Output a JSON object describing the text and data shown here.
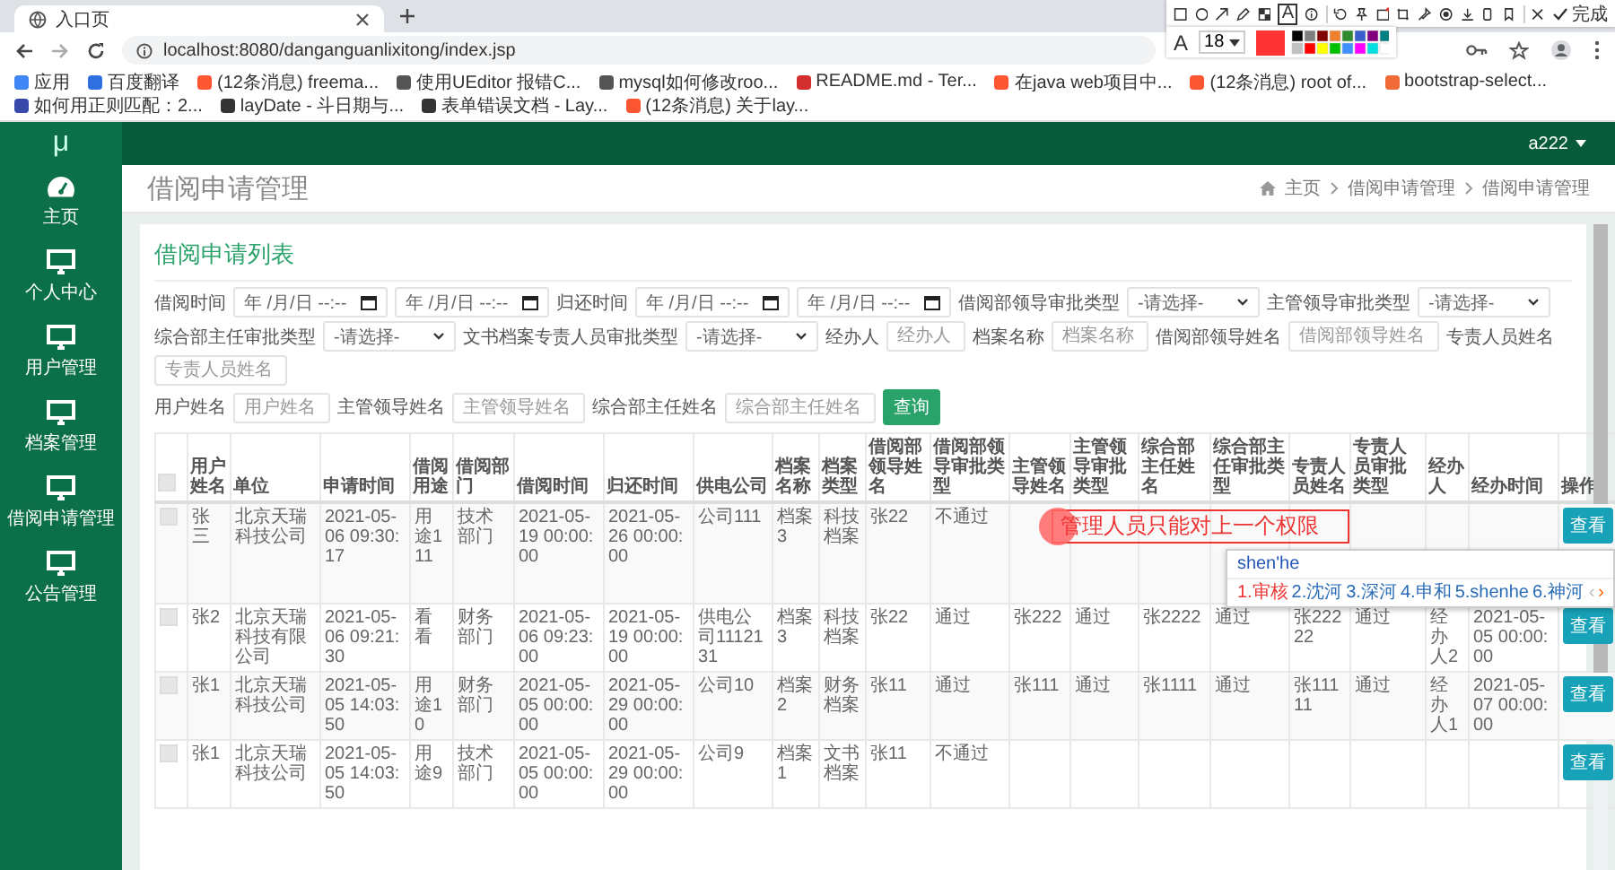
{
  "browser": {
    "tab": "入口页",
    "url": "localhost:8080/danganguanlixitong/index.jsp",
    "bookmarks": [
      {
        "label": "应用",
        "color": "#4285f4"
      },
      {
        "label": "百度翻译",
        "color": "#2f6fe0"
      },
      {
        "label": "(12条消息) freema...",
        "color": "#fc5531"
      },
      {
        "label": "使用UEditor 报错C...",
        "color": "#555555"
      },
      {
        "label": "mysql如何修改roo...",
        "color": "#555555"
      },
      {
        "label": "README.md - Ter...",
        "color": "#d32f2f"
      },
      {
        "label": "在java web项目中...",
        "color": "#fc5531"
      },
      {
        "label": "(12条消息) root of...",
        "color": "#fc5531"
      },
      {
        "label": "bootstrap-select...",
        "color": "#f06a3a"
      },
      {
        "label": "如何用正则匹配：2...",
        "color": "#3949ab"
      },
      {
        "label": "layDate - 斗日期与...",
        "color": "#333333"
      },
      {
        "label": "表单错误文档 - Lay...",
        "color": "#333333"
      },
      {
        "label": "(12条消息) 关于lay...",
        "color": "#fc5531"
      }
    ]
  },
  "annotation_toolbar": {
    "text_tool": "A",
    "font_tool": "A",
    "font_size": "18",
    "done": "完成"
  },
  "header": {
    "logo": "μ",
    "user": "a222"
  },
  "sidebar": {
    "items": [
      {
        "label": "主页",
        "kind": "gauge"
      },
      {
        "label": "个人中心",
        "kind": "monitor"
      },
      {
        "label": "用户管理",
        "kind": "monitor"
      },
      {
        "label": "档案管理",
        "kind": "monitor"
      },
      {
        "label": "借阅申请管理",
        "kind": "monitor"
      },
      {
        "label": "公告管理",
        "kind": "monitor"
      }
    ]
  },
  "page": {
    "title": "借阅申请管理",
    "breadcrumb": [
      "主页",
      "借阅申请管理",
      "借阅申请管理"
    ]
  },
  "card": {
    "title": "借阅申请列表",
    "filter_rows": [
      [
        {
          "kind": "label",
          "text": "借阅时间"
        },
        {
          "kind": "date",
          "placeholder": "年 /月/日 --:--"
        },
        {
          "kind": "date",
          "placeholder": "年 /月/日 --:--"
        },
        {
          "kind": "label",
          "text": "归还时间"
        },
        {
          "kind": "date",
          "placeholder": "年 /月/日 --:--"
        },
        {
          "kind": "date",
          "placeholder": "年 /月/日 --:--"
        },
        {
          "kind": "label",
          "text": "借阅部领导审批类型"
        },
        {
          "kind": "select",
          "value": "-请选择-"
        },
        {
          "kind": "label",
          "text": "主管领导审批类型"
        },
        {
          "kind": "select",
          "value": "-请选择-"
        }
      ],
      [
        {
          "kind": "label",
          "text": "综合部主任审批类型"
        },
        {
          "kind": "select",
          "value": "-请选择-"
        },
        {
          "kind": "label",
          "text": "文书档案专责人员审批类型"
        },
        {
          "kind": "select",
          "value": "-请选择-"
        },
        {
          "kind": "label",
          "text": "经办人"
        },
        {
          "kind": "text",
          "placeholder": "经办人"
        },
        {
          "kind": "label",
          "text": "档案名称"
        },
        {
          "kind": "text",
          "placeholder": "档案名称"
        },
        {
          "kind": "label",
          "text": "借阅部领导姓名"
        },
        {
          "kind": "text",
          "placeholder": "借阅部领导姓名"
        },
        {
          "kind": "label",
          "text": "专责人员姓名"
        },
        {
          "kind": "text",
          "placeholder": "专责人员姓名"
        }
      ],
      [
        {
          "kind": "label",
          "text": "用户姓名"
        },
        {
          "kind": "text",
          "placeholder": "用户姓名"
        },
        {
          "kind": "label",
          "text": "主管领导姓名"
        },
        {
          "kind": "text",
          "placeholder": "主管领导姓名"
        },
        {
          "kind": "label",
          "text": "综合部主任姓名"
        },
        {
          "kind": "text",
          "placeholder": "综合部主任姓名"
        },
        {
          "kind": "button",
          "text": "查询"
        }
      ]
    ],
    "table": {
      "all_checked": false,
      "columns": [
        "用户姓名",
        "单位",
        "申请时间",
        "借阅用途",
        "借阅部门",
        "借阅时间",
        "归还时间",
        "供电公司",
        "档案名称",
        "档案类型",
        "借阅部领导姓名",
        "借阅部领导审批类型",
        "主管领导姓名",
        "主管领导审批类型",
        "综合部主任姓名",
        "综合部主任审批类型",
        "专责人员姓名",
        "专责人员审批类型",
        "经办人",
        "经办时间",
        "操作"
      ],
      "rows": [
        {
          "checked": false,
          "cells": [
            "张三",
            "北京天瑞科技公司",
            "2021-05-06 09:30:17",
            "用途111",
            "技术部门",
            "2021-05-19 00:00:00",
            "2021-05-26 00:00:00",
            "公司111",
            "档案3",
            "科技档案",
            "张22",
            "不通过",
            null,
            null,
            null,
            null,
            null,
            null,
            null,
            null
          ],
          "action": "查看"
        },
        {
          "checked": false,
          "cells": [
            "张2",
            "北京天瑞科技有限公司",
            "2021-05-06 09:21:30",
            "看看",
            "财务部门",
            "2021-05-06 09:23:00",
            "2021-05-19 00:00:00",
            "供电公司1112131",
            "档案3",
            "科技档案",
            "张22",
            "通过",
            "张222",
            "通过",
            "张2222",
            "通过",
            "张22222",
            "通过",
            "经办人2",
            "2021-05-05 00:00:00"
          ],
          "action": "查看"
        },
        {
          "checked": false,
          "cells": [
            "张1",
            "北京天瑞科技公司",
            "2021-05-05 14:03:50",
            "用途10",
            "财务部门",
            "2021-05-05 00:00:00",
            "2021-05-29 00:00:00",
            "公司10",
            "档案2",
            "财务档案",
            "张11",
            "通过",
            "张111",
            "通过",
            "张1111",
            "通过",
            "张11111",
            "通过",
            "经办人1",
            "2021-05-07 00:00:00"
          ],
          "action": "查看"
        },
        {
          "checked": false,
          "cells": [
            "张1",
            "北京天瑞科技公司",
            "2021-05-05 14:03:50",
            "用途9",
            "技术部门",
            "2021-05-05 00:00:00",
            "2021-05-29 00:00:00",
            "公司9",
            "档案1",
            "文书档案",
            "张11",
            "不通过",
            null,
            null,
            null,
            null,
            null,
            null,
            null,
            null
          ],
          "action": "查看"
        }
      ]
    }
  },
  "annotation": {
    "text": "管理人员只能对上一个权限"
  },
  "ime": {
    "composition": "shen'he",
    "prev": "‹",
    "next": "›",
    "candidates": [
      {
        "label": "1.审核",
        "selected": true
      },
      {
        "label": "2.沈河",
        "selected": false
      },
      {
        "label": "3.深河",
        "selected": false
      },
      {
        "label": "4.申和",
        "selected": false
      },
      {
        "label": "5.shenhe",
        "selected": false
      },
      {
        "label": "6.神河",
        "selected": false
      }
    ]
  }
}
